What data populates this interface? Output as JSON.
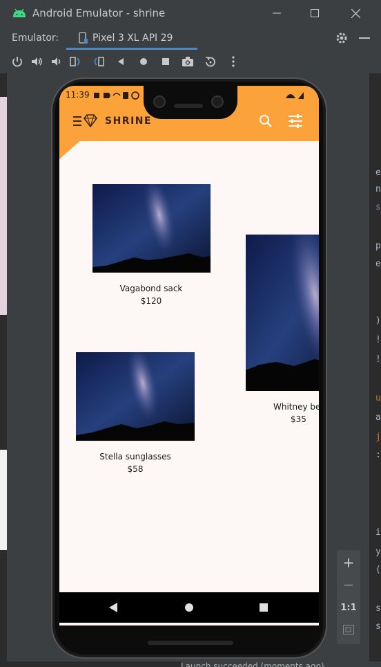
{
  "window": {
    "title": "Android Emulator - shrine",
    "minimize_icon": "minimize-icon",
    "maximize_icon": "maximize-icon",
    "close_icon": "close-icon"
  },
  "emulator_bar": {
    "label": "Emulator:",
    "device_tab": "Pixel 3 XL API 29",
    "accent": "#4a88c7"
  },
  "controls": [
    "power-icon",
    "volume-up-icon",
    "volume-down-icon",
    "rotate-left-icon",
    "rotate-right-icon",
    "back-icon",
    "home-icon",
    "overview-icon",
    "camera-icon",
    "replay-icon",
    "more-icon"
  ],
  "zoom_panel": {
    "plus": "+",
    "minus": "−",
    "one_to_one": "1:1"
  },
  "status_bottom": "Launch succeeded (moments ago)",
  "right_code_glyphs": [
    "e",
    "n",
    "s",
    "p",
    "e",
    ")",
    "!",
    "!",
    "u",
    "a",
    "j",
    ":",
    "i",
    "y",
    "(",
    "s",
    "s"
  ],
  "phone": {
    "status_time": "11:39",
    "app": {
      "brand": "SHRINE",
      "brand_color": "#fca23b"
    },
    "products": [
      {
        "name": "Vagabond sack",
        "price": "$120"
      },
      {
        "name": "Whitney belt",
        "price": "$35"
      },
      {
        "name": "Stella sunglasses",
        "price": "$58"
      }
    ]
  }
}
